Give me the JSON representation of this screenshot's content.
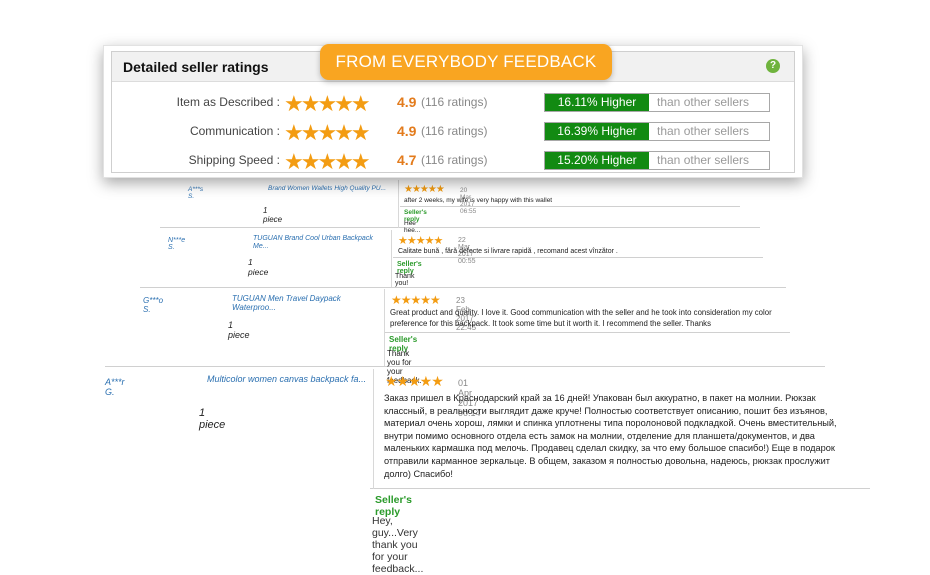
{
  "panel": {
    "title": "Detailed seller ratings",
    "badge": "FROM EVERYBODY FEEDBACK",
    "help_icon": "question-circle-icon",
    "ratings": [
      {
        "label": "Item as Described :",
        "stars": "★★★★★",
        "score": "4.9",
        "count": "(116 ratings)",
        "compare_pct": "16.11% Higher",
        "compare_text": "than other sellers"
      },
      {
        "label": "Communication :",
        "stars": "★★★★★",
        "score": "4.9",
        "count": "(116 ratings)",
        "compare_pct": "16.39% Higher",
        "compare_text": "than other sellers"
      },
      {
        "label": "Shipping Speed :",
        "stars": "★★★★★",
        "score": "4.7",
        "count": "(116 ratings)",
        "compare_pct": "15.20% Higher",
        "compare_text": "than other sellers"
      }
    ]
  },
  "feedback": [
    {
      "buyer": "A***s S.",
      "product": "Brand Women Wallets High Quality PU...",
      "quantity": "1 piece",
      "stars": "★★★★★",
      "date": "20 Mar 2017 06:55",
      "text": "after 2 weeks, my wife is very happy with this wallet",
      "reply_label": "Seller's reply",
      "reply_text": "Hee hee..."
    },
    {
      "buyer": "N***e S.",
      "product": "TUGUAN Brand Cool Urban Backpack Me...",
      "quantity": "1 piece",
      "stars": "★★★★★",
      "date": "22 Mar 2017 00:55",
      "text": "Calitate bună , fără defecte si livrare rapidă , recomand acest vînzător .",
      "reply_label": "Seller's reply",
      "reply_text": "Thank you!"
    },
    {
      "buyer": "G***o S.",
      "product": "TUGUAN Men Travel Daypack Waterproo...",
      "quantity": "1 piece",
      "stars": "★★★★★",
      "date": "23 Feb 2017 22:45",
      "text": "Great product and quality. I love it. Good communication with the seller and he took into consideration my color preference for this backpack. It took some time but it worth it. I recommend the seller. Thanks",
      "reply_label": "Seller's reply",
      "reply_text": "Thank you for your feedback."
    },
    {
      "buyer": "A***r G.",
      "product": "Multicolor women canvas backpack fa...",
      "quantity": "1 piece",
      "stars": "★★★★★",
      "date": "01 Apr 2017 00:14",
      "text": "Заказ пришел в Краснодарский край за 16 дней! Упакован был аккуратно, в пакет на молнии. Рюкзак классный, в реальности выглядит даже круче! Полностью соответствует описанию, пошит без изъянов, материал очень хорош, лямки и спинка уплотнены типа поролоновой подкладкой. Очень вместительный, внутри помимо основного отдела есть замок на молнии, отделение для планшета/документов, и два маленьких кармашка под мелочь. Продавец сделал скидку, за что ему большое спасибо!) Еще в подарок отправили карманное зеркальце. В общем, заказом я полностью довольна, надеюсь, рюкзак прослужит долго) Спасибо!",
      "reply_label": "Seller's reply",
      "reply_text": "Hey, guy...Very thank you for your feedback..."
    }
  ]
}
